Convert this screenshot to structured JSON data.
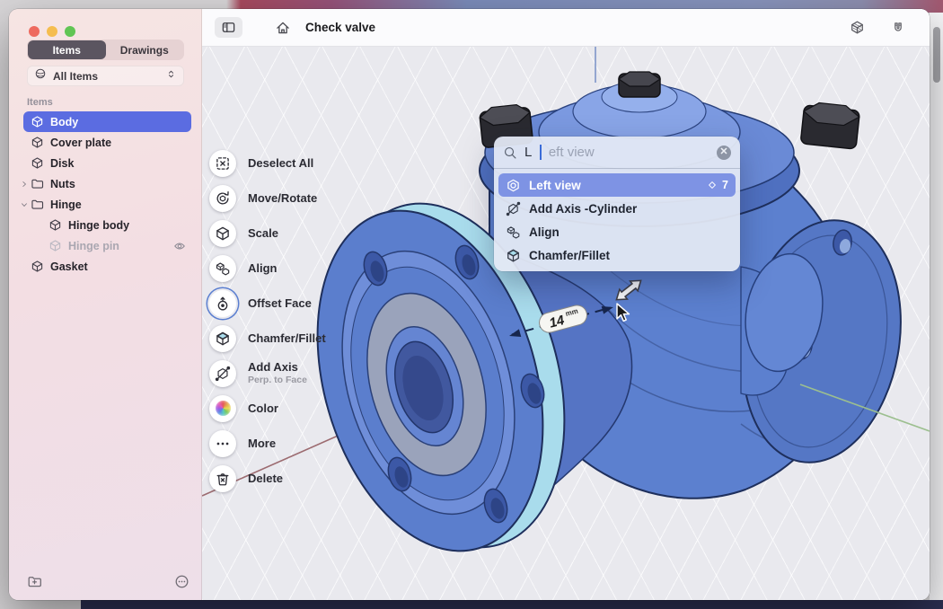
{
  "titlebar": {
    "title": "Check valve",
    "icons": [
      "sidebar-toggle-icon",
      "home-icon",
      "materials-box-icon",
      "snap-magnet-icon"
    ]
  },
  "sidebar": {
    "tabs": [
      "Items",
      "Drawings"
    ],
    "active_tab": "Items",
    "filter_label": "All Items",
    "section_label": "Items",
    "items": [
      {
        "label": "Body",
        "icon": "cube",
        "selected": true
      },
      {
        "label": "Cover plate",
        "icon": "cube"
      },
      {
        "label": "Disk",
        "icon": "cube"
      },
      {
        "label": "Nuts",
        "icon": "folder",
        "expand": "collapsed"
      },
      {
        "label": "Hinge",
        "icon": "folder",
        "expand": "expanded"
      },
      {
        "label": "Hinge body",
        "icon": "cube",
        "indent": 1
      },
      {
        "label": "Hinge pin",
        "icon": "cube",
        "indent": 1,
        "dimmed": true,
        "visibility": "hidden"
      },
      {
        "label": "Gasket",
        "icon": "cube"
      }
    ]
  },
  "toolbar": {
    "items": [
      {
        "label": "Deselect All",
        "icon": "deselect"
      },
      {
        "label": "Move/Rotate",
        "icon": "move-rotate"
      },
      {
        "label": "Scale",
        "icon": "scale"
      },
      {
        "label": "Align",
        "icon": "align"
      },
      {
        "label": "Offset Face",
        "icon": "offset-face",
        "active": true
      },
      {
        "label": "Chamfer/Fillet",
        "icon": "chamfer"
      },
      {
        "label": "Add Axis",
        "sublabel": "Perp. to Face",
        "icon": "add-axis"
      },
      {
        "label": "Color",
        "icon": "color"
      },
      {
        "label": "More",
        "icon": "more"
      },
      {
        "label": "Delete",
        "icon": "delete"
      }
    ]
  },
  "search": {
    "query": "L",
    "completion": "eft view",
    "results": [
      {
        "label": "Left view",
        "icon": "view-cube",
        "selected": true,
        "shortcut": "7"
      },
      {
        "label": "Add Axis -Cylinder",
        "icon": "add-axis"
      },
      {
        "label": "Align",
        "icon": "align"
      },
      {
        "label": "Chamfer/Fillet",
        "icon": "chamfer"
      }
    ]
  },
  "viewport": {
    "dimension": {
      "value": "14",
      "unit": "mm"
    },
    "model_name": "Check valve body"
  },
  "colors": {
    "selection_blue": "#5b6ce1",
    "result_highlight": "#7e93e4",
    "model_blue": "#5b7ecd",
    "rim_cyan": "#a9dcec",
    "face_gray": "#9aa3bb"
  }
}
